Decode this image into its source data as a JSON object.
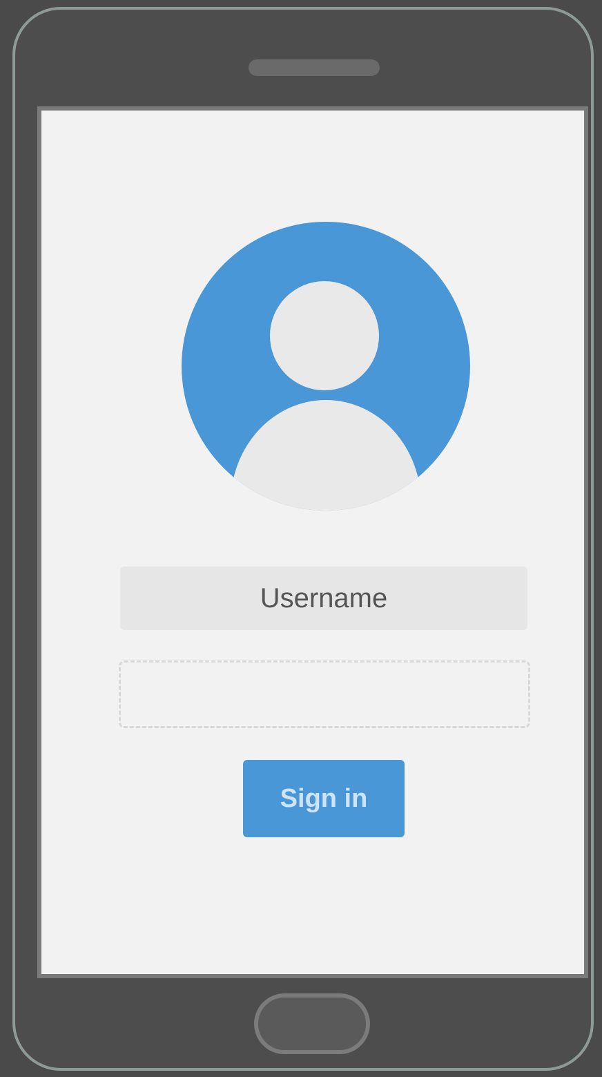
{
  "login": {
    "username_label": "Username",
    "password_value": "",
    "signin_label": "Sign in"
  },
  "colors": {
    "accent": "#4a97d8",
    "screen_bg": "#f2f2f2",
    "device_body": "#4d4d4d"
  },
  "icons": {
    "avatar": "user-avatar-icon"
  }
}
